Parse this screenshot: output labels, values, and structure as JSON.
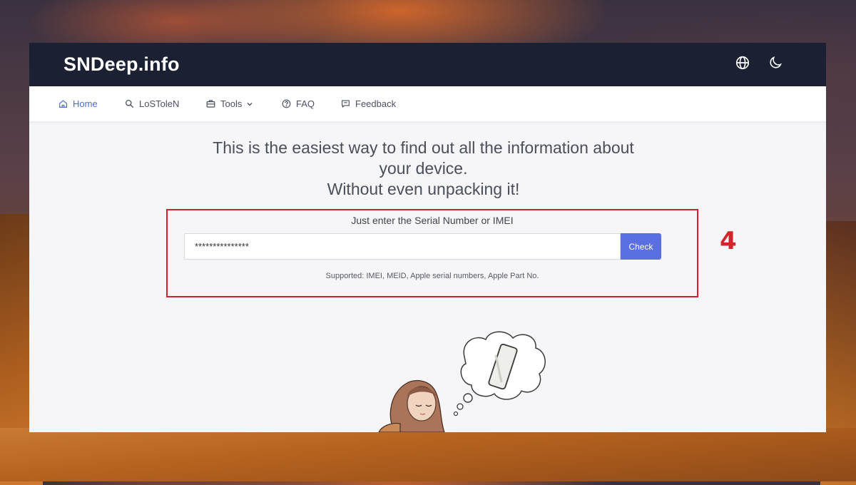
{
  "site": {
    "logo": "SNDeep.info"
  },
  "header": {
    "icons": [
      "globe-icon",
      "moon-icon"
    ]
  },
  "nav": {
    "items": [
      {
        "label": "Home",
        "icon": "home-icon",
        "active": true
      },
      {
        "label": "LoSToleN",
        "icon": "search-icon"
      },
      {
        "label": "Tools",
        "icon": "toolbox-icon",
        "dropdown": true
      },
      {
        "label": "FAQ",
        "icon": "question-icon"
      },
      {
        "label": "Feedback",
        "icon": "chat-icon"
      }
    ]
  },
  "hero": {
    "line1": "This is the easiest way to find out all the information about",
    "line2": "your device.",
    "line3": "Without even unpacking it!"
  },
  "form": {
    "label": "Just enter the Serial Number or IMEI",
    "input_value": "***************",
    "button_label": "Check",
    "supported_text": "Supported: IMEI, MEID, Apple serial numbers, Apple Part No."
  },
  "annotation": {
    "step": "4",
    "color": "#d3242b"
  },
  "colors": {
    "header_bg": "#1b2132",
    "accent": "#5a6fe0",
    "active_nav": "#4f6bd8"
  }
}
